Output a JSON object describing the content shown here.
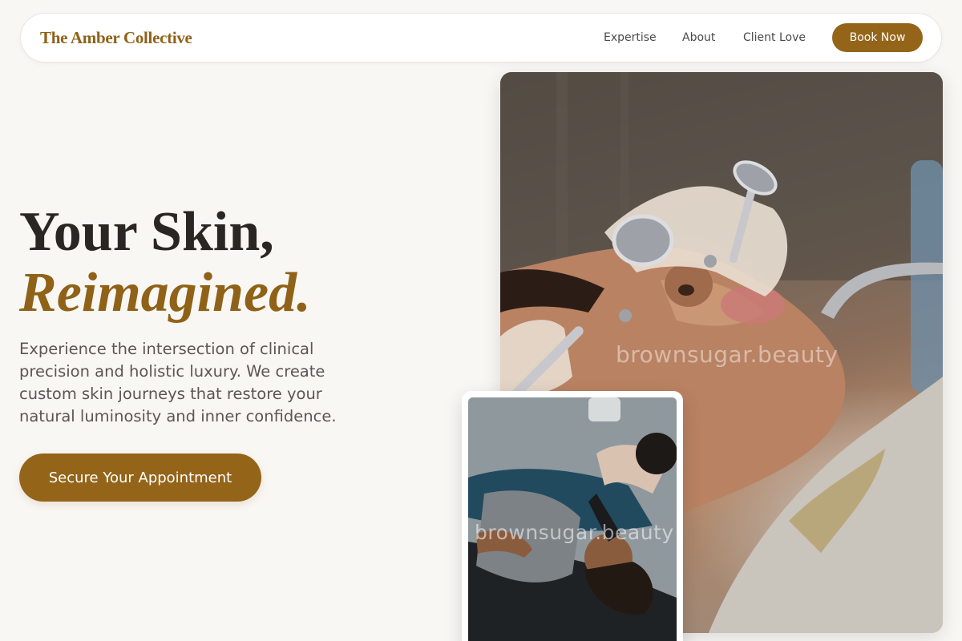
{
  "brand": {
    "name": "The Amber Collective"
  },
  "nav": {
    "links": [
      "Expertise",
      "About",
      "Client Love"
    ],
    "cta_label": "Book Now"
  },
  "hero": {
    "title_line1": "Your Skin,",
    "title_line2": "Reimagined.",
    "description": "Experience the intersection of clinical precision and holistic luxury. We create custom skin journeys that restore your natural luminosity and inner confidence.",
    "cta_label": "Secure Your Appointment"
  },
  "images": {
    "main_watermark": "brownsugar.beauty",
    "secondary_watermark": "brownsugar.beauty"
  },
  "colors": {
    "accent": "#946419",
    "brand_text": "#8f6218",
    "background": "#f9f7f4",
    "heading": "#2a2623",
    "body_text": "#5a5653"
  }
}
